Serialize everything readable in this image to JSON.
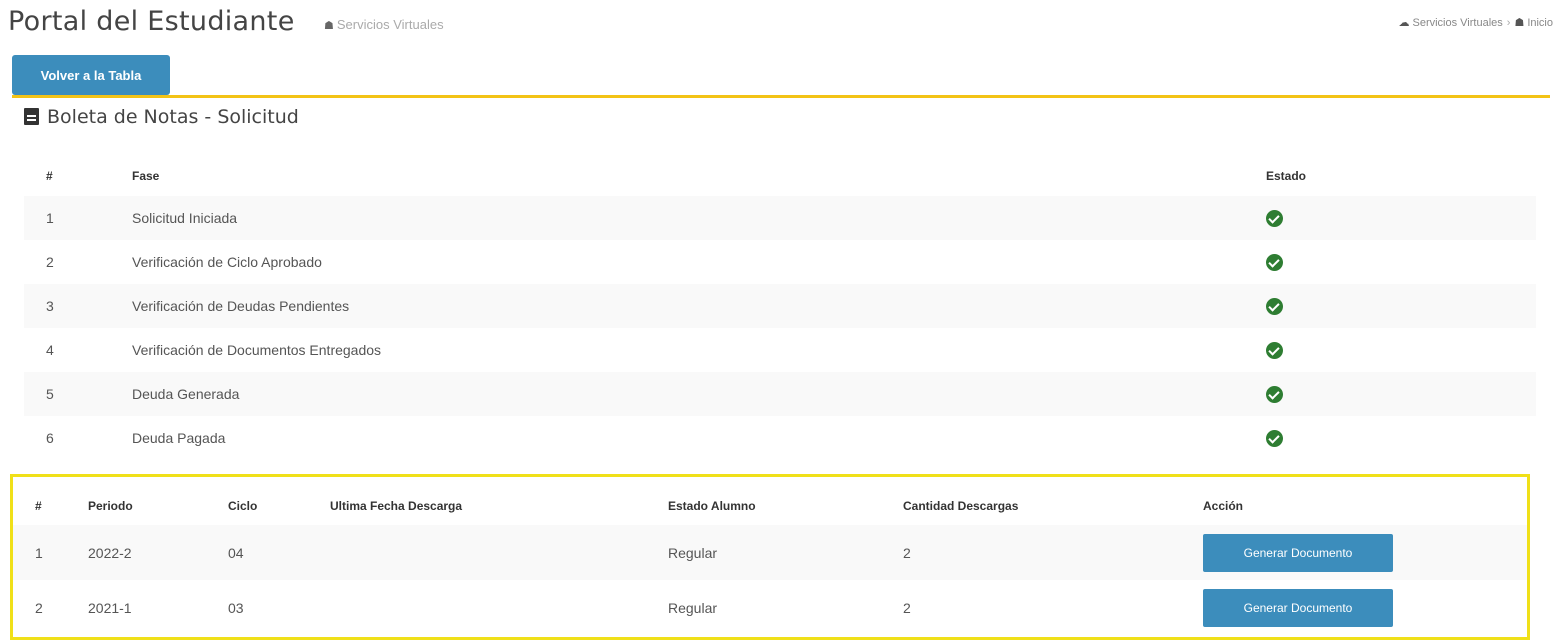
{
  "header": {
    "title": "Portal del Estudiante",
    "subtitle": "Servicios Virtuales",
    "breadcrumb": [
      "Servicios Virtuales",
      "Inicio"
    ]
  },
  "back_button_label": "Volver a la Tabla",
  "panel": {
    "heading": "Boleta de Notas - Solicitud",
    "columns": {
      "num": "#",
      "fase": "Fase",
      "estado": "Estado"
    },
    "rows": [
      {
        "num": "1",
        "fase": "Solicitud Iniciada"
      },
      {
        "num": "2",
        "fase": "Verificación de Ciclo Aprobado"
      },
      {
        "num": "3",
        "fase": "Verificación de Deudas Pendientes"
      },
      {
        "num": "4",
        "fase": "Verificación de Documentos Entregados"
      },
      {
        "num": "5",
        "fase": "Deuda Generada"
      },
      {
        "num": "6",
        "fase": "Deuda Pagada"
      }
    ]
  },
  "downloads": {
    "columns": {
      "num": "#",
      "periodo": "Periodo",
      "ciclo": "Ciclo",
      "fecha": "Ultima Fecha Descarga",
      "estado": "Estado Alumno",
      "cantidad": "Cantidad Descargas",
      "accion": "Acción"
    },
    "rows": [
      {
        "num": "1",
        "periodo": "2022-2",
        "ciclo": "04",
        "fecha": "",
        "estado": "Regular",
        "cantidad": "2",
        "accion": "Generar Documento"
      },
      {
        "num": "2",
        "periodo": "2021-1",
        "ciclo": "03",
        "fecha": "",
        "estado": "Regular",
        "cantidad": "2",
        "accion": "Generar Documento"
      }
    ]
  },
  "colors": {
    "primary": "#3c8dbc",
    "accent_line": "#f3c316",
    "highlight_border": "#f0e018",
    "check": "#2e7d32"
  },
  "icons": {
    "subtitle": "home-icon",
    "breadcrumb_1": "cloud-icon",
    "breadcrumb_2": "home-icon",
    "heading": "file-icon",
    "status": "check-circle-icon"
  }
}
